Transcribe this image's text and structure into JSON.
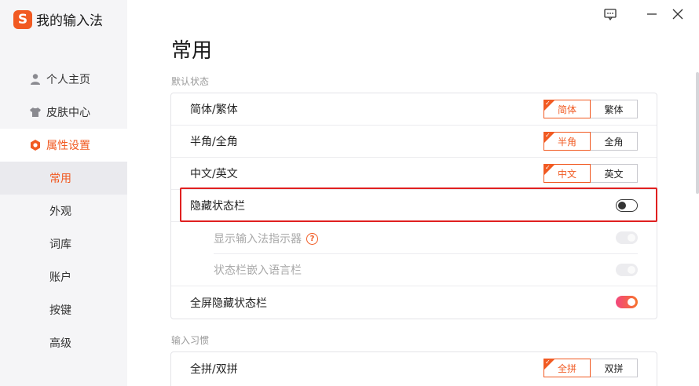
{
  "app": {
    "title": "我的输入法",
    "logo_char": "S"
  },
  "sidebar": {
    "items": [
      {
        "label": "个人主页",
        "icon": "person-icon"
      },
      {
        "label": "皮肤中心",
        "icon": "shirt-icon"
      },
      {
        "label": "属性设置",
        "icon": "hexagon-settings-icon"
      }
    ],
    "sub_items": [
      {
        "label": "常用"
      },
      {
        "label": "外观"
      },
      {
        "label": "词库"
      },
      {
        "label": "账户"
      },
      {
        "label": "按键"
      },
      {
        "label": "高级"
      }
    ]
  },
  "colors": {
    "accent": "#f15a22",
    "highlight": "#e02020"
  },
  "page": {
    "title": "常用",
    "sections": [
      {
        "label": "默认状态",
        "rows": [
          {
            "label": "简体/繁体",
            "options": [
              "简体",
              "繁体"
            ],
            "selected": 0
          },
          {
            "label": "半角/全角",
            "options": [
              "半角",
              "全角"
            ],
            "selected": 0
          },
          {
            "label": "中文/英文",
            "options": [
              "中文",
              "英文"
            ],
            "selected": 0
          },
          {
            "label": "隐藏状态栏",
            "toggle": "off"
          },
          {
            "label": "显示输入法指示器",
            "toggle": "disabled"
          },
          {
            "label": "状态栏嵌入语言栏",
            "toggle": "disabled"
          },
          {
            "label": "全屏隐藏状态栏",
            "toggle": "on"
          }
        ]
      },
      {
        "label": "输入习惯",
        "rows": [
          {
            "label": "全拼/双拼",
            "options": [
              "全拼",
              "双拼"
            ],
            "selected": 0
          }
        ]
      }
    ]
  }
}
